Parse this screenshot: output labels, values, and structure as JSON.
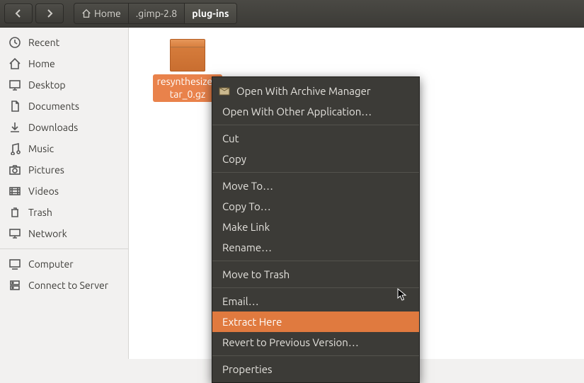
{
  "breadcrumbs": {
    "home": "Home",
    "mid": ".gimp-2.8",
    "current": "plug-ins"
  },
  "sidebar": {
    "items": [
      {
        "label": "Recent"
      },
      {
        "label": "Home"
      },
      {
        "label": "Desktop"
      },
      {
        "label": "Documents"
      },
      {
        "label": "Downloads"
      },
      {
        "label": "Music"
      },
      {
        "label": "Pictures"
      },
      {
        "label": "Videos"
      },
      {
        "label": "Trash"
      },
      {
        "label": "Network"
      }
    ],
    "items2": [
      {
        "label": "Computer"
      },
      {
        "label": "Connect to Server"
      }
    ]
  },
  "file": {
    "name_line1": "resynthesizer.",
    "name_line2": "tar_0.gz"
  },
  "context_menu": {
    "items": [
      {
        "label": "Open With Archive Manager",
        "icon": true
      },
      {
        "label": "Open With Other Application…"
      },
      {
        "sep": true
      },
      {
        "label": "Cut"
      },
      {
        "label": "Copy"
      },
      {
        "sep": true
      },
      {
        "label": "Move To…"
      },
      {
        "label": "Copy To…"
      },
      {
        "label": "Make Link"
      },
      {
        "label": "Rename…"
      },
      {
        "sep": true
      },
      {
        "label": "Move to Trash"
      },
      {
        "sep": true
      },
      {
        "label": "Email…"
      },
      {
        "label": "Extract Here",
        "hover": true
      },
      {
        "label": "Revert to Previous Version…"
      },
      {
        "sep": true
      },
      {
        "label": "Properties"
      }
    ]
  }
}
